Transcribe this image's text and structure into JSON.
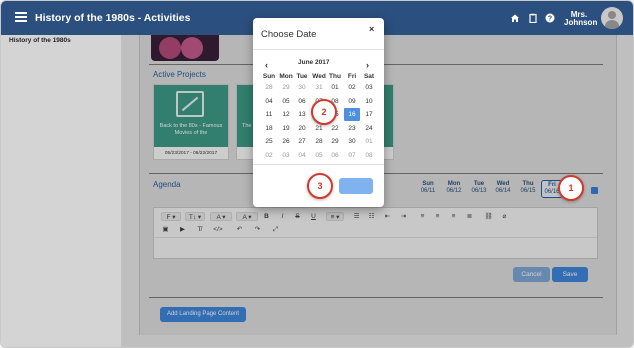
{
  "header": {
    "title": "History of the 1980s - Activities",
    "user_name": "Mrs.\nJohnson",
    "user_line1": "Mrs.",
    "user_line2": "Johnson",
    "color": "#2b4f7e"
  },
  "sidebar": {
    "items": [
      {
        "label": "History of the 1980s"
      }
    ]
  },
  "main": {
    "active_projects_label": "Active Projects",
    "projects": [
      {
        "name": "Back to the 80s - Famous Movies of the",
        "dates": "05/23/2017 - 06/22/2017"
      },
      {
        "name": "The",
        "dates": ""
      }
    ],
    "agenda_label": "Agenda",
    "days": [
      {
        "name": "Sun",
        "date": "06/11"
      },
      {
        "name": "Mon",
        "date": "06/12"
      },
      {
        "name": "Tue",
        "date": "06/13"
      },
      {
        "name": "Wed",
        "date": "06/14"
      },
      {
        "name": "Thu",
        "date": "06/15"
      },
      {
        "name": "Fri",
        "date": "06/16"
      }
    ],
    "cancel_label": "Cancel",
    "save_label": "Save",
    "add_landing_label": "Add Landing Page Content"
  },
  "editor_toolbar": {
    "font_label": "F",
    "size_label": "T",
    "color_label": "A",
    "bg_label": "A"
  },
  "modal": {
    "title": "Choose Date",
    "close_glyph": "×",
    "month_label": "June 2017",
    "prev_glyph": "‹",
    "next_glyph": "›",
    "weekdays": [
      "Sun",
      "Mon",
      "Tue",
      "Wed",
      "Thu",
      "Fri",
      "Sat"
    ],
    "weeks": [
      [
        "28",
        "29",
        "30",
        "31",
        "01",
        "02",
        "03"
      ],
      [
        "04",
        "05",
        "06",
        "07",
        "08",
        "09",
        "10"
      ],
      [
        "11",
        "12",
        "13",
        "14",
        "15",
        "16",
        "17"
      ],
      [
        "18",
        "19",
        "20",
        "21",
        "22",
        "23",
        "24"
      ],
      [
        "25",
        "26",
        "27",
        "28",
        "29",
        "30",
        "01"
      ],
      [
        "02",
        "03",
        "04",
        "05",
        "06",
        "07",
        "08"
      ]
    ],
    "selected_day": "16"
  },
  "callouts": [
    {
      "label": "1"
    },
    {
      "label": "2"
    },
    {
      "label": "3"
    }
  ],
  "colors": {
    "accent": "#3f86dc",
    "callout": "#d0392c",
    "project_card": "#3e9c88"
  }
}
